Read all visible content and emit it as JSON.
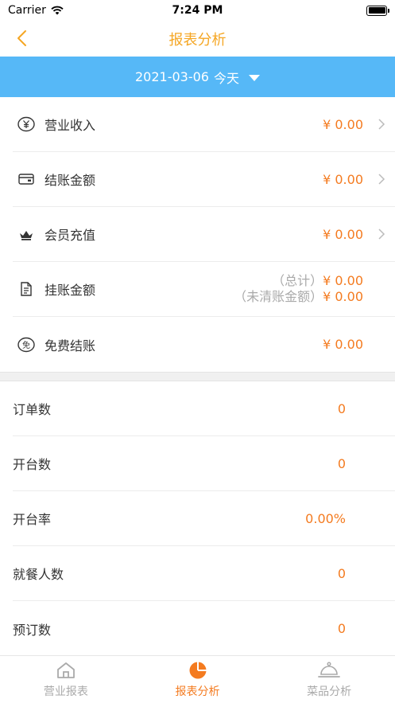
{
  "status_bar": {
    "carrier": "Carrier",
    "time": "7:24 PM"
  },
  "nav": {
    "title": "报表分析"
  },
  "date_selector": {
    "date": "2021-03-06",
    "suffix": "今天"
  },
  "money_rows": [
    {
      "label": "营业收入",
      "value": "¥ 0.00",
      "icon": "yen-circle-icon"
    },
    {
      "label": "结账金额",
      "value": "¥ 0.00",
      "icon": "card-icon"
    },
    {
      "label": "会员充值",
      "value": "¥ 0.00",
      "icon": "crown-icon"
    },
    {
      "label": "挂账金额",
      "total_label": "（总计）",
      "total_value": "¥ 0.00",
      "unsettled_label": "（未清账金额）",
      "unsettled_value": "¥ 0.00",
      "icon": "document-icon"
    },
    {
      "label": "免费结账",
      "value": "¥ 0.00",
      "icon": "free-circle-icon",
      "icon_text": "免"
    }
  ],
  "stat_rows": [
    {
      "label": "订单数",
      "value": "0"
    },
    {
      "label": "开台数",
      "value": "0"
    },
    {
      "label": "开台率",
      "value": "0.00%"
    },
    {
      "label": "就餐人数",
      "value": "0"
    },
    {
      "label": "预订数",
      "value": "0"
    }
  ],
  "tabs": [
    {
      "label": "营业报表",
      "icon": "home-icon",
      "active": false
    },
    {
      "label": "报表分析",
      "icon": "pie-chart-icon",
      "active": true
    },
    {
      "label": "菜品分析",
      "icon": "cloche-icon",
      "active": false
    }
  ],
  "colors": {
    "accent": "#f47b20",
    "title": "#f5a623",
    "date_bar": "#56b8f7"
  }
}
